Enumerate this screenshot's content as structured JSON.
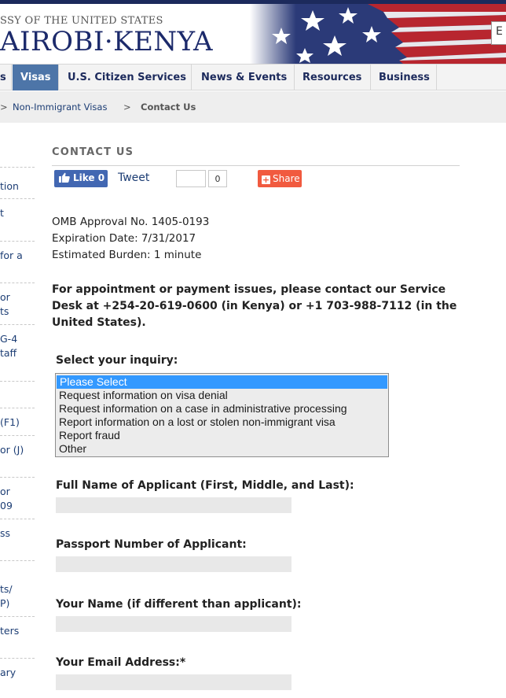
{
  "header": {
    "embassy_prefix": "SSY OF THE UNITED STATES",
    "city_title": "AIROBI·KENYA",
    "search_partial": "E"
  },
  "nav": {
    "items": [
      {
        "label": "s"
      },
      {
        "label": "Visas"
      },
      {
        "label": "U.S. Citizen Services"
      },
      {
        "label": "News & Events"
      },
      {
        "label": "Resources"
      },
      {
        "label": "Business"
      }
    ]
  },
  "breadcrumb": {
    "items": [
      {
        "label": ">"
      },
      {
        "label": "Non-Immigrant Visas"
      },
      {
        "label": ">"
      },
      {
        "label": "Contact Us"
      }
    ]
  },
  "sidebar": {
    "fragments": [
      "tion",
      "t",
      "for a",
      "or",
      "ts",
      "G-4",
      "taff",
      "(F1)",
      "or (J)",
      "or",
      "09",
      "ss",
      "ts/",
      "P)",
      "ters",
      "ary"
    ]
  },
  "main": {
    "section_title": "CONTACT US",
    "social": {
      "like_label": "Like 0",
      "tweet_label": "Tweet",
      "count_value": "0",
      "share_label": "Share"
    },
    "omb": {
      "approval": "OMB Approval No. 1405-0193",
      "expiration": "Expiration Date: 7/31/2017",
      "burden": "Estimated Burden: 1 minute"
    },
    "notice": "For appointment or payment issues, please contact our Service Desk at +254-20-619-0600 (in Kenya) or +1 703-988-7112 (in the United States).",
    "form": {
      "inquiry_label": "Select your inquiry:",
      "inquiry_options": [
        "Please Select",
        "Request information on visa denial",
        "Request information on a case in administrative processing",
        "Report information on a lost or stolen non-immigrant visa",
        "Report fraud",
        "Other"
      ],
      "inquiry_selected_index": 0,
      "full_name_label": "Full Name of Applicant (First, Middle, and Last):",
      "passport_label": "Passport Number of Applicant:",
      "your_name_label": "Your Name (if different than applicant):",
      "email_label": "Your Email Address:*"
    }
  },
  "colors": {
    "nav_active": "#4d75a8",
    "link": "#1c3d74",
    "facebook": "#4267b2",
    "share": "#f15a3f",
    "list_selection": "#3399ff"
  }
}
